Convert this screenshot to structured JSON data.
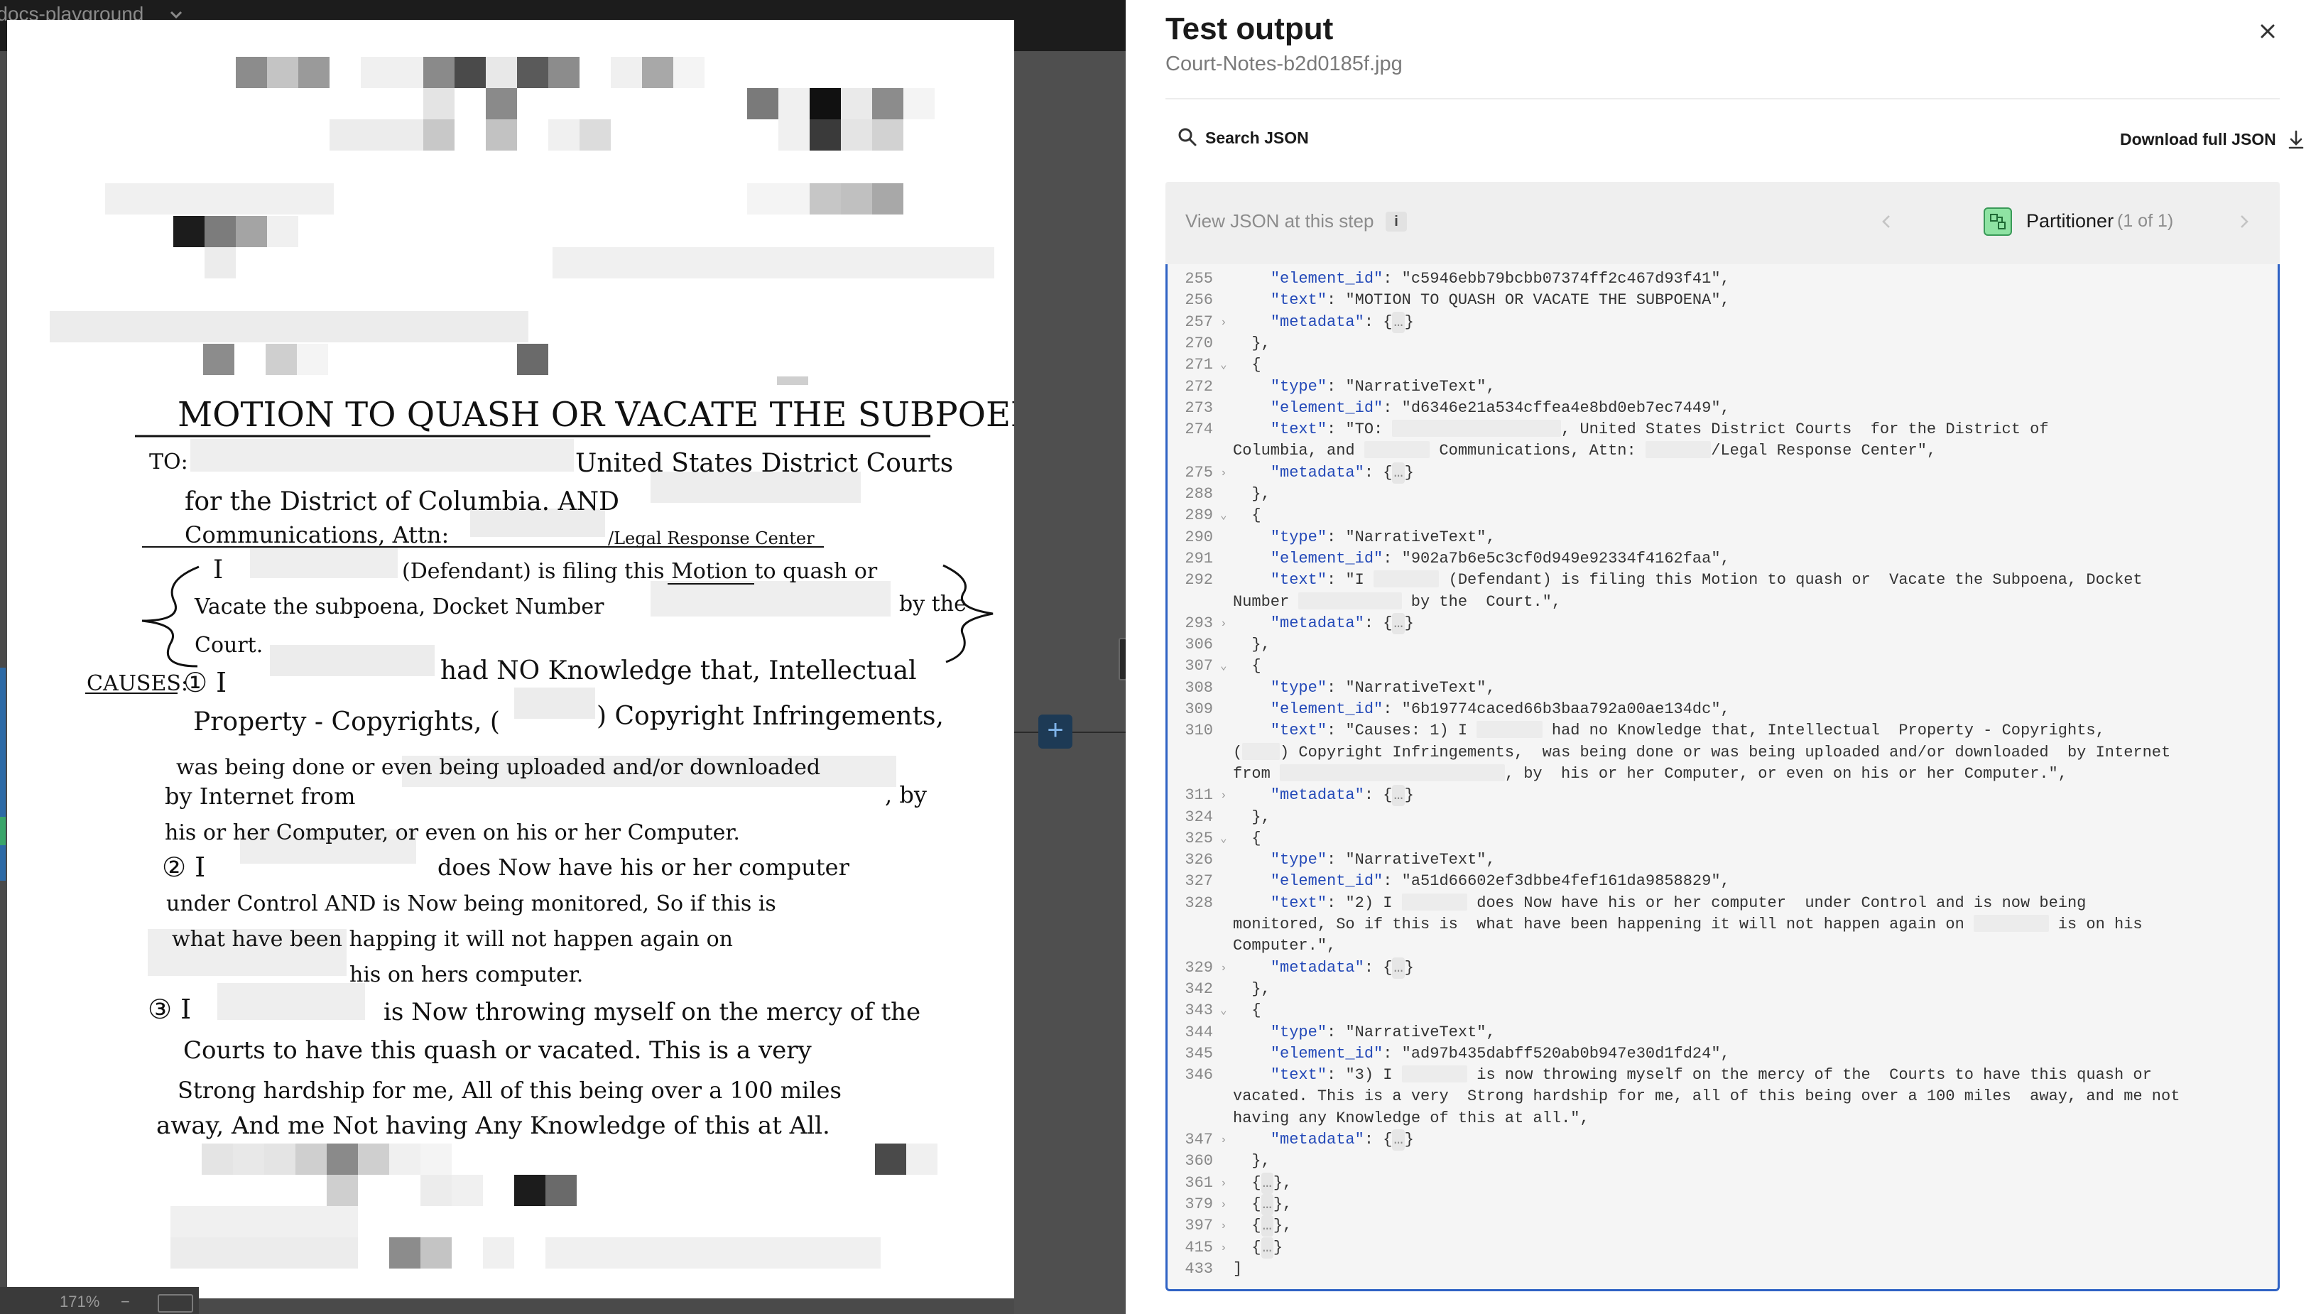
{
  "viewer": {
    "project_name": "-docs-playground",
    "zoom": "171%",
    "zoom_minus": "−"
  },
  "document": {
    "title": "MOTION TO QUASH OR VACATE THE SUBPOENA",
    "lines": [
      "TO:",
      "United States District Courts",
      "for the District of Columbia. AND",
      "Communications, Attn:",
      "/Legal Response Center",
      "I",
      "(Defendant) is filing this Motion to quash or",
      "Vacate the subpoena, Docket Number",
      "by the",
      "Court.",
      "CAUSES:",
      "① I",
      "had NO Knowledge that, Intellectual",
      "Property - Copyrights, (",
      ") Copyright Infringements,",
      "was being done or even being uploaded and/or downloaded",
      "by Internet from",
      ", by",
      "his or her Computer, or even on his or her Computer.",
      "② I",
      "does Now have his or her computer",
      "under Control AND is Now being monitored, So if this is",
      "what have been happing it will not happen again on",
      "his on hers computer.",
      "③ I",
      "is Now throwing myself on the mercy of the",
      "Courts to have this quash or vacated. This is a very",
      "Strong hardship for me, All of this being over a 100 miles",
      "away, And me Not having Any Knowledge of this at All."
    ]
  },
  "panel": {
    "title": "Test output",
    "filename": "Court-Notes-b2d0185f.jpg",
    "search_placeholder": "Search JSON",
    "download_label": "Download full JSON",
    "view_json_label": "View JSON at this step",
    "info_label": "i",
    "step_name": "Partitioner",
    "step_count": "(1 of 1)"
  },
  "json_lines": [
    {
      "n": "255",
      "fold": "",
      "t": [
        [
          "    ",
          ""
        ],
        [
          "\"element_id\"",
          "k"
        ],
        [
          ": ",
          ""
        ],
        [
          "\"c5946ebb79bcbb07374ff2c467d93f41\"",
          "s"
        ],
        [
          ",",
          ""
        ]
      ]
    },
    {
      "n": "256",
      "fold": "",
      "t": [
        [
          "    ",
          ""
        ],
        [
          "\"text\"",
          "k"
        ],
        [
          ": ",
          ""
        ],
        [
          "\"MOTION TO QUASH OR VACATE THE SUBPOENA\"",
          "s"
        ],
        [
          ",",
          ""
        ]
      ]
    },
    {
      "n": "257",
      "fold": "›",
      "t": [
        [
          "    ",
          ""
        ],
        [
          "\"metadata\"",
          "k"
        ],
        [
          ": {",
          ""
        ],
        [
          "…",
          "c"
        ],
        [
          "}",
          ""
        ]
      ]
    },
    {
      "n": "270",
      "fold": "",
      "t": [
        [
          "  },",
          ""
        ]
      ]
    },
    {
      "n": "271",
      "fold": "⌄",
      "t": [
        [
          "  {",
          ""
        ]
      ]
    },
    {
      "n": "272",
      "fold": "",
      "t": [
        [
          "    ",
          ""
        ],
        [
          "\"type\"",
          "k"
        ],
        [
          ": ",
          ""
        ],
        [
          "\"NarrativeText\"",
          "s"
        ],
        [
          ",",
          ""
        ]
      ]
    },
    {
      "n": "273",
      "fold": "",
      "t": [
        [
          "    ",
          ""
        ],
        [
          "\"element_id\"",
          "k"
        ],
        [
          ": ",
          ""
        ],
        [
          "\"d6346e21a534cffea4e8bd0eb7ec7449\"",
          "s"
        ],
        [
          ",",
          ""
        ]
      ]
    },
    {
      "n": "274",
      "fold": "",
      "t": [
        [
          "    ",
          ""
        ],
        [
          "\"text\"",
          "k"
        ],
        [
          ": ",
          ""
        ],
        [
          "\"TO: ",
          "s"
        ],
        [
          "R18",
          "r"
        ],
        [
          ", United States District Courts  for the District of",
          "s"
        ]
      ]
    },
    {
      "n": "",
      "fold": "",
      "t": [
        [
          "Columbia, and ",
          "s"
        ],
        [
          "R7",
          "r"
        ],
        [
          " Communications, Attn: ",
          "s"
        ],
        [
          "R7",
          "r"
        ],
        [
          "/Legal Response Center\"",
          "s"
        ],
        [
          ",",
          ""
        ]
      ]
    },
    {
      "n": "275",
      "fold": "›",
      "t": [
        [
          "    ",
          ""
        ],
        [
          "\"metadata\"",
          "k"
        ],
        [
          ": {",
          ""
        ],
        [
          "…",
          "c"
        ],
        [
          "}",
          ""
        ]
      ]
    },
    {
      "n": "288",
      "fold": "",
      "t": [
        [
          "  },",
          ""
        ]
      ]
    },
    {
      "n": "289",
      "fold": "⌄",
      "t": [
        [
          "  {",
          ""
        ]
      ]
    },
    {
      "n": "290",
      "fold": "",
      "t": [
        [
          "    ",
          ""
        ],
        [
          "\"type\"",
          "k"
        ],
        [
          ": ",
          ""
        ],
        [
          "\"NarrativeText\"",
          "s"
        ],
        [
          ",",
          ""
        ]
      ]
    },
    {
      "n": "291",
      "fold": "",
      "t": [
        [
          "    ",
          ""
        ],
        [
          "\"element_id\"",
          "k"
        ],
        [
          ": ",
          ""
        ],
        [
          "\"902a7b6e5c3cf0d949e92334f4162faa\"",
          "s"
        ],
        [
          ",",
          ""
        ]
      ]
    },
    {
      "n": "292",
      "fold": "",
      "t": [
        [
          "    ",
          ""
        ],
        [
          "\"text\"",
          "k"
        ],
        [
          ": ",
          ""
        ],
        [
          "\"I ",
          "s"
        ],
        [
          "R7",
          "r"
        ],
        [
          " (Defendant) is filing this Motion to quash or  Vacate the Subpoena, Docket",
          "s"
        ]
      ]
    },
    {
      "n": "",
      "fold": "",
      "t": [
        [
          "Number ",
          "s"
        ],
        [
          "R11",
          "r"
        ],
        [
          " by the  Court.\"",
          "s"
        ],
        [
          ",",
          ""
        ]
      ]
    },
    {
      "n": "293",
      "fold": "›",
      "t": [
        [
          "    ",
          ""
        ],
        [
          "\"metadata\"",
          "k"
        ],
        [
          ": {",
          ""
        ],
        [
          "…",
          "c"
        ],
        [
          "}",
          ""
        ]
      ]
    },
    {
      "n": "306",
      "fold": "",
      "t": [
        [
          "  },",
          ""
        ]
      ]
    },
    {
      "n": "307",
      "fold": "⌄",
      "t": [
        [
          "  {",
          ""
        ]
      ]
    },
    {
      "n": "308",
      "fold": "",
      "t": [
        [
          "    ",
          ""
        ],
        [
          "\"type\"",
          "k"
        ],
        [
          ": ",
          ""
        ],
        [
          "\"NarrativeText\"",
          "s"
        ],
        [
          ",",
          ""
        ]
      ]
    },
    {
      "n": "309",
      "fold": "",
      "t": [
        [
          "    ",
          ""
        ],
        [
          "\"element_id\"",
          "k"
        ],
        [
          ": ",
          ""
        ],
        [
          "\"6b19774caced66b3baa792a00ae134dc\"",
          "s"
        ],
        [
          ",",
          ""
        ]
      ]
    },
    {
      "n": "310",
      "fold": "",
      "t": [
        [
          "    ",
          ""
        ],
        [
          "\"text\"",
          "k"
        ],
        [
          ": ",
          ""
        ],
        [
          "\"Causes: 1) I ",
          "s"
        ],
        [
          "R7",
          "r"
        ],
        [
          " had no Knowledge that, Intellectual  Property - Copyrights,",
          "s"
        ]
      ]
    },
    {
      "n": "",
      "fold": "",
      "t": [
        [
          "(",
          "s"
        ],
        [
          "R4",
          "r"
        ],
        [
          ") Copyright Infringements,  was being done or was being uploaded and/or downloaded  by Internet",
          "s"
        ]
      ]
    },
    {
      "n": "",
      "fold": "",
      "t": [
        [
          "from ",
          "s"
        ],
        [
          "R24",
          "r"
        ],
        [
          ", by  his or her Computer, or even on his or her Computer.\"",
          "s"
        ],
        [
          ",",
          ""
        ]
      ]
    },
    {
      "n": "311",
      "fold": "›",
      "t": [
        [
          "    ",
          ""
        ],
        [
          "\"metadata\"",
          "k"
        ],
        [
          ": {",
          ""
        ],
        [
          "…",
          "c"
        ],
        [
          "}",
          ""
        ]
      ]
    },
    {
      "n": "324",
      "fold": "",
      "t": [
        [
          "  },",
          ""
        ]
      ]
    },
    {
      "n": "325",
      "fold": "⌄",
      "t": [
        [
          "  {",
          ""
        ]
      ]
    },
    {
      "n": "326",
      "fold": "",
      "t": [
        [
          "    ",
          ""
        ],
        [
          "\"type\"",
          "k"
        ],
        [
          ": ",
          ""
        ],
        [
          "\"NarrativeText\"",
          "s"
        ],
        [
          ",",
          ""
        ]
      ]
    },
    {
      "n": "327",
      "fold": "",
      "t": [
        [
          "    ",
          ""
        ],
        [
          "\"element_id\"",
          "k"
        ],
        [
          ": ",
          ""
        ],
        [
          "\"a51d66602ef3dbbe4fef161da9858829\"",
          "s"
        ],
        [
          ",",
          ""
        ]
      ]
    },
    {
      "n": "328",
      "fold": "",
      "t": [
        [
          "    ",
          ""
        ],
        [
          "\"text\"",
          "k"
        ],
        [
          ": ",
          ""
        ],
        [
          "\"2) I ",
          "s"
        ],
        [
          "R7",
          "r"
        ],
        [
          " does Now have his or her computer  under Control and is now being",
          "s"
        ]
      ]
    },
    {
      "n": "",
      "fold": "",
      "t": [
        [
          "monitored, So if this is  what have been happening it will not happen again on ",
          "s"
        ],
        [
          "R8",
          "r"
        ],
        [
          " is on his",
          "s"
        ]
      ]
    },
    {
      "n": "",
      "fold": "",
      "t": [
        [
          "Computer.\"",
          "s"
        ],
        [
          ",",
          ""
        ]
      ]
    },
    {
      "n": "329",
      "fold": "›",
      "t": [
        [
          "    ",
          ""
        ],
        [
          "\"metadata\"",
          "k"
        ],
        [
          ": {",
          ""
        ],
        [
          "…",
          "c"
        ],
        [
          "}",
          ""
        ]
      ]
    },
    {
      "n": "342",
      "fold": "",
      "t": [
        [
          "  },",
          ""
        ]
      ]
    },
    {
      "n": "343",
      "fold": "⌄",
      "t": [
        [
          "  {",
          ""
        ]
      ]
    },
    {
      "n": "344",
      "fold": "",
      "t": [
        [
          "    ",
          ""
        ],
        [
          "\"type\"",
          "k"
        ],
        [
          ": ",
          ""
        ],
        [
          "\"NarrativeText\"",
          "s"
        ],
        [
          ",",
          ""
        ]
      ]
    },
    {
      "n": "345",
      "fold": "",
      "t": [
        [
          "    ",
          ""
        ],
        [
          "\"element_id\"",
          "k"
        ],
        [
          ": ",
          ""
        ],
        [
          "\"ad97b435dabff520ab0b947e30d1fd24\"",
          "s"
        ],
        [
          ",",
          ""
        ]
      ]
    },
    {
      "n": "346",
      "fold": "",
      "t": [
        [
          "    ",
          ""
        ],
        [
          "\"text\"",
          "k"
        ],
        [
          ": ",
          ""
        ],
        [
          "\"3) I ",
          "s"
        ],
        [
          "R7",
          "r"
        ],
        [
          " is now throwing myself on the mercy of the  Courts to have this quash or",
          "s"
        ]
      ]
    },
    {
      "n": "",
      "fold": "",
      "t": [
        [
          "vacated. This is a very  Strong hardship for me, all of this being over a 100 miles  away, and me not",
          "s"
        ]
      ]
    },
    {
      "n": "",
      "fold": "",
      "t": [
        [
          "having any Knowledge of this at all.\"",
          "s"
        ],
        [
          ",",
          ""
        ]
      ]
    },
    {
      "n": "347",
      "fold": "›",
      "t": [
        [
          "    ",
          ""
        ],
        [
          "\"metadata\"",
          "k"
        ],
        [
          ": {",
          ""
        ],
        [
          "…",
          "c"
        ],
        [
          "}",
          ""
        ]
      ]
    },
    {
      "n": "360",
      "fold": "",
      "t": [
        [
          "  },",
          ""
        ]
      ]
    },
    {
      "n": "361",
      "fold": "›",
      "t": [
        [
          "  {",
          ""
        ],
        [
          "…",
          "c"
        ],
        [
          "},",
          ""
        ]
      ]
    },
    {
      "n": "379",
      "fold": "›",
      "t": [
        [
          "  {",
          ""
        ],
        [
          "…",
          "c"
        ],
        [
          "},",
          ""
        ]
      ]
    },
    {
      "n": "397",
      "fold": "›",
      "t": [
        [
          "  {",
          ""
        ],
        [
          "…",
          "c"
        ],
        [
          "},",
          ""
        ]
      ]
    },
    {
      "n": "415",
      "fold": "›",
      "t": [
        [
          "  {",
          ""
        ],
        [
          "…",
          "c"
        ],
        [
          "}",
          ""
        ]
      ]
    },
    {
      "n": "433",
      "fold": "",
      "t": [
        [
          "]",
          ""
        ]
      ]
    }
  ]
}
